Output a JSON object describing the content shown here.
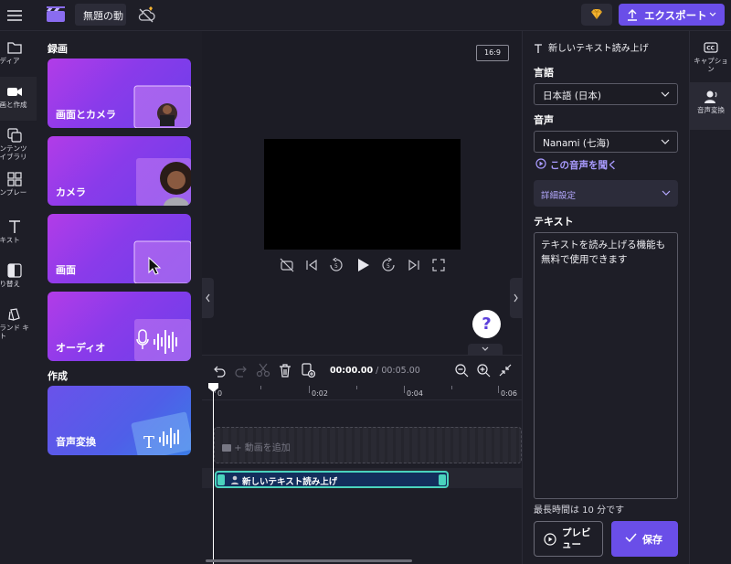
{
  "topbar": {
    "project_title": "無題の動",
    "export_label": "エクスポート"
  },
  "nav": [
    {
      "label": "メディア",
      "icon": "folder-icon"
    },
    {
      "label": "録画と作成",
      "icon": "video-camera-icon"
    },
    {
      "label": "コンテンツ\nライブラリ",
      "icon": "library-icon"
    },
    {
      "label": "テンプレー\nト",
      "icon": "templates-icon"
    },
    {
      "label": "テキスト",
      "icon": "text-icon"
    },
    {
      "label": "切り替え",
      "icon": "transitions-icon"
    },
    {
      "label": "ブランド キ\nット",
      "icon": "brand-kit-icon"
    }
  ],
  "record_panel": {
    "record_heading": "録画",
    "cards": [
      "画面とカメラ",
      "カメラ",
      "画面",
      "オーディオ"
    ],
    "create_heading": "作成",
    "create_cards": [
      "音声変換"
    ]
  },
  "preview": {
    "aspect_ratio": "16:9"
  },
  "timeline": {
    "current_time": "00:00.00",
    "total_time": "/ 00:05.00",
    "ticks": [
      "0",
      "0:02",
      "0:04",
      "0:06"
    ],
    "add_video_placeholder": "+ 動画を追加",
    "audio_clip_label": "新しいテキスト読み上げ"
  },
  "props": {
    "header": "新しいテキスト読み上げ",
    "language_label": "言語",
    "language_value": "日本語 (日本)",
    "voice_label": "音声",
    "voice_value": "Nanami (七海)",
    "open_voice_link": "この音声を聞く",
    "advanced_label": "詳細設定",
    "text_label": "テキスト",
    "text_value": "テキストを読み上げる機能も無料で使用できます",
    "max_note": "最長時間は 10 分です",
    "preview_label": "プレビ\nュー",
    "save_label": "保存"
  },
  "right_rail": [
    {
      "label": "キャプショ\nン",
      "icon": "captions-icon"
    },
    {
      "label": "音声変換",
      "icon": "text-to-speech-icon"
    }
  ],
  "colors": {
    "accent": "#6a4ee8",
    "clip_border": "#4ad3bd",
    "clip_fill": "#132e5c"
  }
}
